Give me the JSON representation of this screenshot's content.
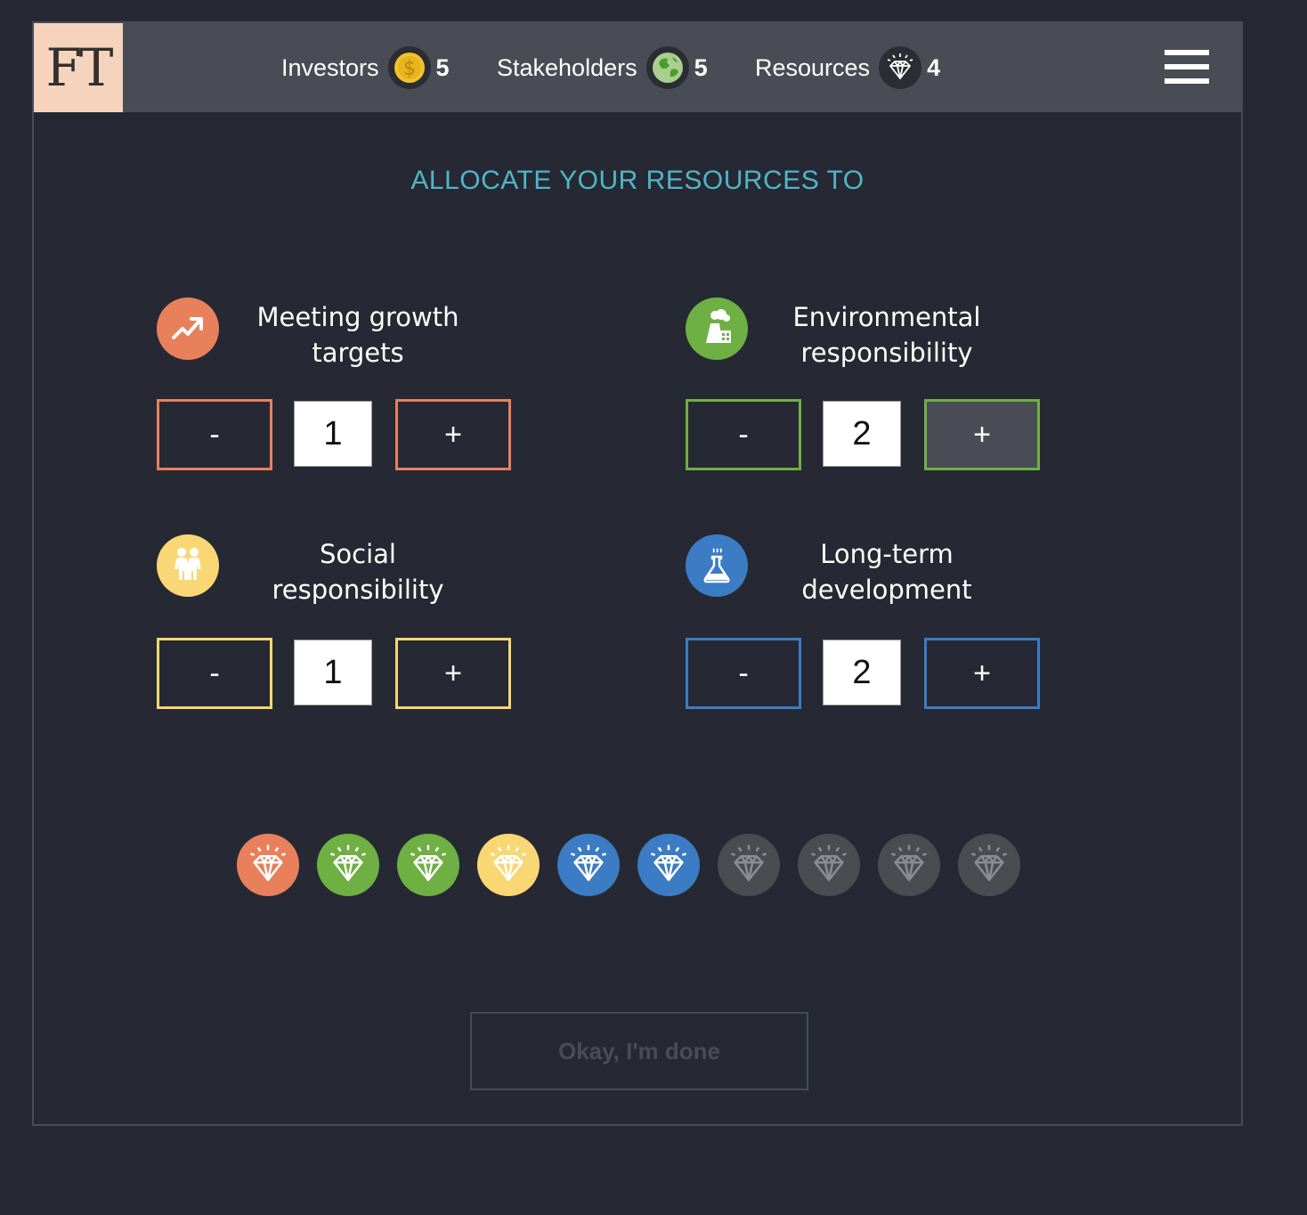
{
  "header": {
    "logo_text": "FT",
    "stats": [
      {
        "label": "Investors",
        "value": "5",
        "icon": "coin-icon"
      },
      {
        "label": "Stakeholders",
        "value": "5",
        "icon": "globe-icon"
      },
      {
        "label": "Resources",
        "value": "4",
        "icon": "diamond-icon"
      }
    ],
    "menu_icon": "hamburger-menu-icon"
  },
  "heading": "ALLOCATE YOUR RESOURCES TO",
  "categories": [
    {
      "title_line1": "Meeting growth",
      "title_line2": "targets",
      "value": "1",
      "minus": "-",
      "plus": "+",
      "color": "#e8805c",
      "icon": "trending-up-icon"
    },
    {
      "title_line1": "Environmental",
      "title_line2": "responsibility",
      "value": "2",
      "minus": "-",
      "plus": "+",
      "color": "#6eb043",
      "icon": "factory-icon"
    },
    {
      "title_line1": "Social",
      "title_line2": "responsibility",
      "value": "1",
      "minus": "-",
      "plus": "+",
      "color": "#f9d774",
      "icon": "people-icon"
    },
    {
      "title_line1": "Long-term",
      "title_line2": "development",
      "value": "2",
      "minus": "-",
      "plus": "+",
      "color": "#3b7cc4",
      "icon": "flask-icon"
    }
  ],
  "resource_tokens": [
    "#e8805c",
    "#6eb043",
    "#6eb043",
    "#f9d774",
    "#3b7cc4",
    "#3b7cc4",
    "#4a4c52",
    "#4a4c52",
    "#4a4c52",
    "#4a4c52"
  ],
  "done_button": "Okay, I'm done"
}
